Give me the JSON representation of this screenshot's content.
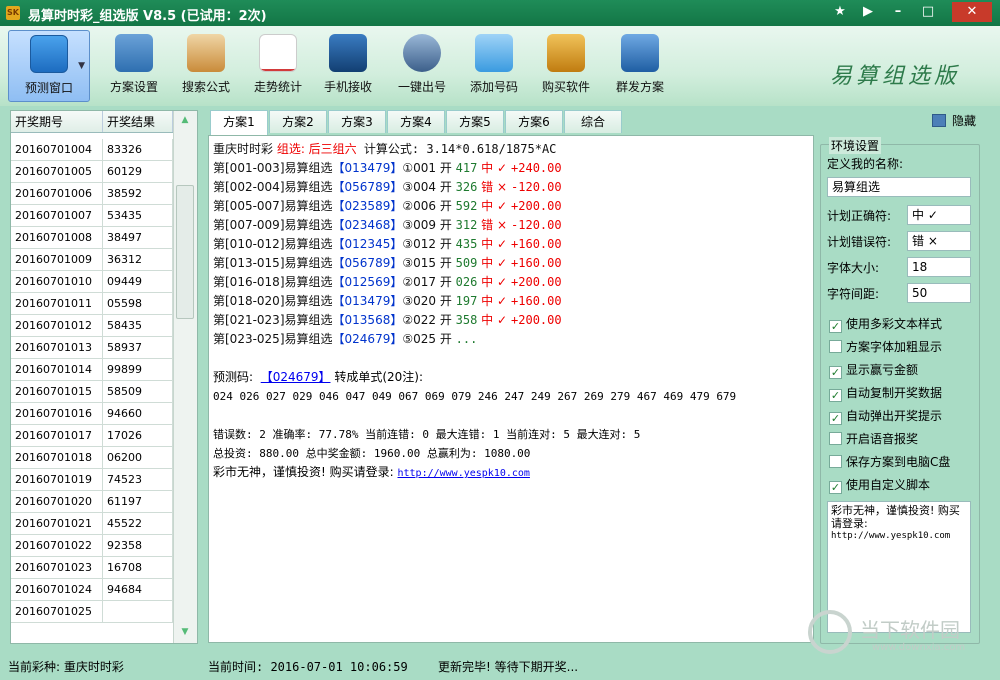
{
  "window": {
    "title": "易算时时彩_组选版 V8.5 (已试用：2次)",
    "app_icon": "app-icon"
  },
  "toolbar": [
    {
      "label": "预测窗口",
      "icon": "cloud-icon",
      "color": "#2a7dc9"
    },
    {
      "label": "方案设置",
      "icon": "settings-monitor-icon",
      "color": "#2e6fb0"
    },
    {
      "label": "搜索公式",
      "icon": "search-document-icon",
      "color": "#c98b3a"
    },
    {
      "label": "走势统计",
      "icon": "trend-chart-icon",
      "color": "#d23a3a"
    },
    {
      "label": "手机接收",
      "icon": "phone-star-icon",
      "color": "#1f5f9f"
    },
    {
      "label": "一键出号",
      "icon": "gear-dial-icon",
      "color": "#3c5f8a"
    },
    {
      "label": "添加号码",
      "icon": "folder-add-icon",
      "color": "#3a9be0"
    },
    {
      "label": "购买软件",
      "icon": "key-icon",
      "color": "#d4961c"
    },
    {
      "label": "群发方案",
      "icon": "users-icon",
      "color": "#2d6fb5"
    }
  ],
  "brand": "易算组选版",
  "left": {
    "headers": [
      "开奖期号",
      "开奖结果"
    ],
    "rows": [
      [
        "20160701004",
        "83326"
      ],
      [
        "20160701005",
        "60129"
      ],
      [
        "20160701006",
        "38592"
      ],
      [
        "20160701007",
        "53435"
      ],
      [
        "20160701008",
        "38497"
      ],
      [
        "20160701009",
        "36312"
      ],
      [
        "20160701010",
        "09449"
      ],
      [
        "20160701011",
        "05598"
      ],
      [
        "20160701012",
        "58435"
      ],
      [
        "20160701013",
        "58937"
      ],
      [
        "20160701014",
        "99899"
      ],
      [
        "20160701015",
        "58509"
      ],
      [
        "20160701016",
        "94660"
      ],
      [
        "20160701017",
        "17026"
      ],
      [
        "20160701018",
        "06200"
      ],
      [
        "20160701019",
        "74523"
      ],
      [
        "20160701020",
        "61197"
      ],
      [
        "20160701021",
        "45522"
      ],
      [
        "20160701022",
        "92358"
      ],
      [
        "20160701023",
        "16708"
      ],
      [
        "20160701024",
        "94684"
      ],
      [
        "20160701025",
        ""
      ]
    ]
  },
  "tabs": [
    "方案1",
    "方案2",
    "方案3",
    "方案4",
    "方案5",
    "方案6",
    "综合"
  ],
  "hide_label": "隐藏",
  "main": {
    "header": {
      "a": "重庆时时彩 ",
      "b": "组选: 后三组六",
      "c": " 计算公式: 3.14*0.618/1875*AC"
    },
    "records": [
      {
        "range": "第[001-003]",
        "name": "易算组选",
        "nums": "【013479】",
        "seq": "①001",
        "open": " 开 ",
        "res": "417",
        "mark": " 中 ✓",
        "amt": "+240.00",
        "hit": true
      },
      {
        "range": "第[002-004]",
        "name": "易算组选",
        "nums": "【056789】",
        "seq": "③004",
        "open": " 开 ",
        "res": "326",
        "mark": " 错 ×",
        "amt": "-120.00",
        "hit": false
      },
      {
        "range": "第[005-007]",
        "name": "易算组选",
        "nums": "【023589】",
        "seq": "②006",
        "open": " 开 ",
        "res": "592",
        "mark": " 中 ✓",
        "amt": "+200.00",
        "hit": true
      },
      {
        "range": "第[007-009]",
        "name": "易算组选",
        "nums": "【023468】",
        "seq": "③009",
        "open": " 开 ",
        "res": "312",
        "mark": " 错 ×",
        "amt": "-120.00",
        "hit": false
      },
      {
        "range": "第[010-012]",
        "name": "易算组选",
        "nums": "【012345】",
        "seq": "③012",
        "open": " 开 ",
        "res": "435",
        "mark": " 中 ✓",
        "amt": "+160.00",
        "hit": true
      },
      {
        "range": "第[013-015]",
        "name": "易算组选",
        "nums": "【056789】",
        "seq": "③015",
        "open": " 开 ",
        "res": "509",
        "mark": " 中 ✓",
        "amt": "+160.00",
        "hit": true
      },
      {
        "range": "第[016-018]",
        "name": "易算组选",
        "nums": "【012569】",
        "seq": "②017",
        "open": " 开 ",
        "res": "026",
        "mark": " 中 ✓",
        "amt": "+200.00",
        "hit": true
      },
      {
        "range": "第[018-020]",
        "name": "易算组选",
        "nums": "【013479】",
        "seq": "③020",
        "open": " 开 ",
        "res": "197",
        "mark": " 中 ✓",
        "amt": "+160.00",
        "hit": true
      },
      {
        "range": "第[021-023]",
        "name": "易算组选",
        "nums": "【013568】",
        "seq": "②022",
        "open": " 开 ",
        "res": "358",
        "mark": " 中 ✓",
        "amt": "+200.00",
        "hit": true
      },
      {
        "range": "第[023-025]",
        "name": "易算组选",
        "nums": "【024679】",
        "seq": "⑤025",
        "open": " 开 ",
        "res": "...",
        "mark": "",
        "amt": "",
        "hit": true
      }
    ],
    "predict_label": "预测码:  ",
    "predict_code": "【024679】",
    "predict_suffix": " 转成单式(20注):",
    "single_list": "024 026 027 029 046 047 049 067 069 079 246 247 249 267 269 279 467 469 479 679",
    "stats1": "错误数: 2 准确率: 77.78% 当前连错: 0 最大连错: 1 当前连对: 5 最大连对: 5",
    "stats2": "总投资: 880.00 总中奖金额: 1960.00 总赢利为: 1080.00",
    "footer_text": "彩市无神，谨慎投资! 购买请登录: ",
    "footer_link": "http://www.yespk10.com"
  },
  "settings": {
    "legend": "环境设置",
    "name_label": "定义我的名称:",
    "name_value": "易算组选",
    "right_label": "计划正确符:",
    "right_value": "中 ✓",
    "wrong_label": "计划错误符:",
    "wrong_value": "错 ×",
    "fontsize_label": "字体大小:",
    "fontsize_value": "18",
    "spacing_label": "字符间距:",
    "spacing_value": "50",
    "checks": [
      {
        "label": "使用多彩文本样式",
        "checked": true
      },
      {
        "label": "方案字体加粗显示",
        "checked": false
      },
      {
        "label": "显示赢亏金额",
        "checked": true
      },
      {
        "label": "自动复制开奖数据",
        "checked": true
      },
      {
        "label": "自动弹出开奖提示",
        "checked": true
      },
      {
        "label": "开启语音报奖",
        "checked": false
      },
      {
        "label": "保存方案到电脑C盘",
        "checked": false
      },
      {
        "label": "使用自定义脚本",
        "checked": true
      }
    ],
    "note_text": "彩市无神，谨慎投资! 购买请登录:",
    "note_url": "http://www.yespk10.com"
  },
  "status": {
    "lottery": "当前彩种: 重庆时时彩",
    "time": "当前时间: 2016-07-01 10:06:59",
    "msg": "更新完毕! 等待下期开奖..."
  },
  "watermark": {
    "title": "当下软件园",
    "url": "www.downxia.com"
  }
}
